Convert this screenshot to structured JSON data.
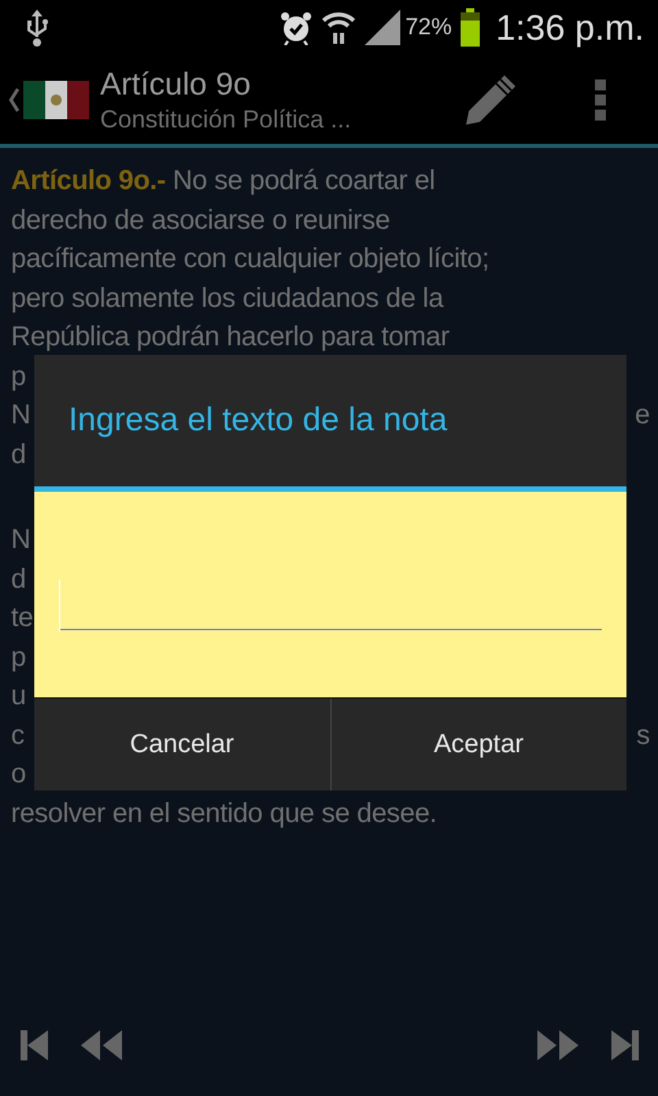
{
  "status_bar": {
    "battery": "72%",
    "time": "1:36 p.m."
  },
  "action_bar": {
    "title": "Artículo 9o",
    "subtitle": "Constitución Política ..."
  },
  "article": {
    "paragraphs": [
      {
        "lines": [
          {
            "left": "**Artículo 9o.-** No se podrá coartar el"
          },
          {
            "left": "derecho de asociarse o reunirse"
          },
          {
            "left": "pacíficamente con cualquier objeto lícito;"
          },
          {
            "left": "pero solamente los ciudadanos de la"
          },
          {
            "left": "República podrán hacerlo para tomar"
          },
          {
            "left": "p"
          },
          {
            "left": "N",
            "right": "e"
          },
          {
            "left": "d"
          }
        ]
      },
      {
        "lines": [
          {
            "left": "N"
          },
          {
            "left": "d"
          },
          {
            "left": "te"
          },
          {
            "left": "p"
          },
          {
            "left": "u"
          },
          {
            "left": "c",
            "right": "s"
          },
          {
            "left": "o"
          },
          {
            "left": "resolver en el sentido que se desee."
          }
        ]
      }
    ]
  },
  "dialog": {
    "title": "Ingresa el texto de la nota",
    "field": {
      "focused": true
    },
    "buttons": [
      {
        "label": "Cancelar"
      },
      {
        "label": "Aceptar"
      }
    ]
  },
  "navigation": {
    "buttons": [
      {
        "kind": "first"
      },
      {
        "kind": "previous"
      },
      {
        "kind": "next"
      },
      {
        "kind": "last"
      }
    ]
  }
}
